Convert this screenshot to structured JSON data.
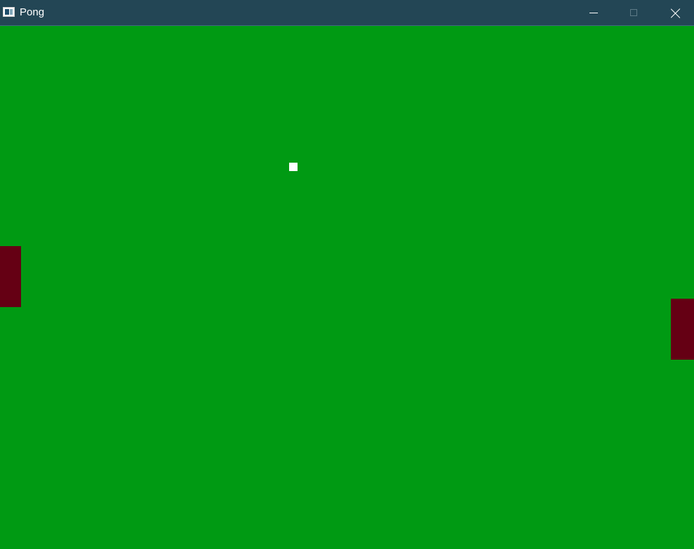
{
  "window": {
    "title": "Pong",
    "icon": "app-window-icon",
    "controls": {
      "minimize": "minimize-icon",
      "maximize": "maximize-icon",
      "close": "close-icon"
    },
    "colors": {
      "titlebar": "#234655",
      "title_text": "#ffffff"
    }
  },
  "game": {
    "colors": {
      "court": "#009a13",
      "paddles": "#650014",
      "ball": "#ffffff"
    }
  }
}
